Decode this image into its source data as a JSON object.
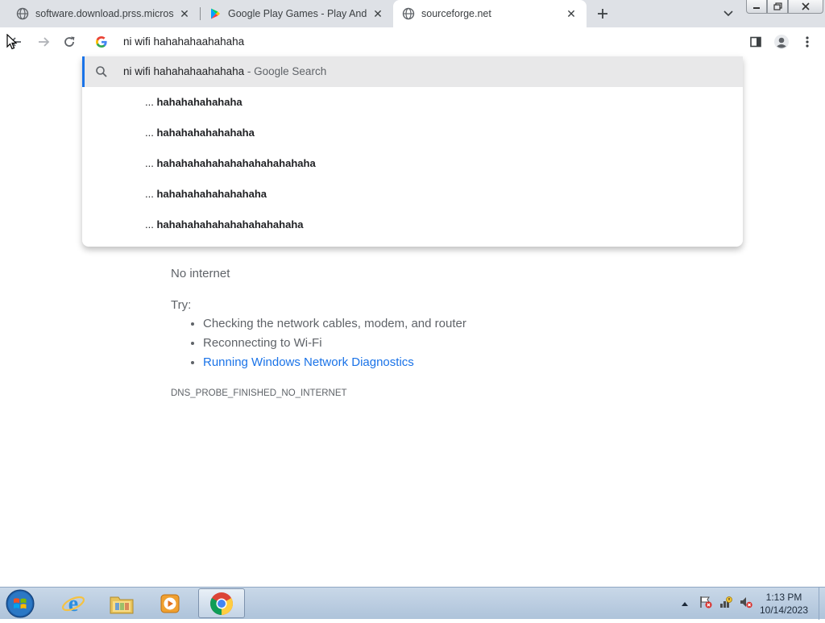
{
  "browser": {
    "tabs": [
      {
        "title": "software.download.prss.microsoft",
        "favicon": "globe-icon",
        "active": false
      },
      {
        "title": "Google Play Games - Play Android",
        "favicon": "google-play-icon",
        "active": false
      },
      {
        "title": "sourceforge.net",
        "favicon": "globe-icon",
        "active": true
      }
    ],
    "window_controls": [
      "minimize",
      "restore",
      "close"
    ]
  },
  "omnibox": {
    "value": "ni wifi hahahahaahahaha",
    "icon": "google-g-icon"
  },
  "suggestions": {
    "first": {
      "query": "ni wifi hahahahaahahaha",
      "separator": " - ",
      "provider": "Google Search"
    },
    "items": [
      {
        "prefix": "... ",
        "bold": "hahahahahahaha"
      },
      {
        "prefix": "... ",
        "bold": "hahahahahahahaha"
      },
      {
        "prefix": "... ",
        "bold": "hahahahahahahahahahahahaha"
      },
      {
        "prefix": "... ",
        "bold": "hahahahahahahahaha"
      },
      {
        "prefix": "... ",
        "bold": "hahahahahahahahahahahaha"
      }
    ]
  },
  "page": {
    "title": "No internet",
    "try_label": "Try:",
    "steps": [
      "Checking the network cables, modem, and router",
      "Reconnecting to Wi-Fi"
    ],
    "diagnostics_link": "Running Windows Network Diagnostics",
    "error_code": "DNS_PROBE_FINISHED_NO_INTERNET"
  },
  "taskbar": {
    "apps": [
      "internet-explorer-icon",
      "file-explorer-icon",
      "media-player-icon",
      "chrome-icon"
    ],
    "clock": {
      "time": "1:13 PM",
      "date": "10/14/2023"
    }
  },
  "colors": {
    "accent": "#1a73e8",
    "tabstrip": "#dee1e6",
    "suggestion_highlight": "#e8e8e9"
  }
}
